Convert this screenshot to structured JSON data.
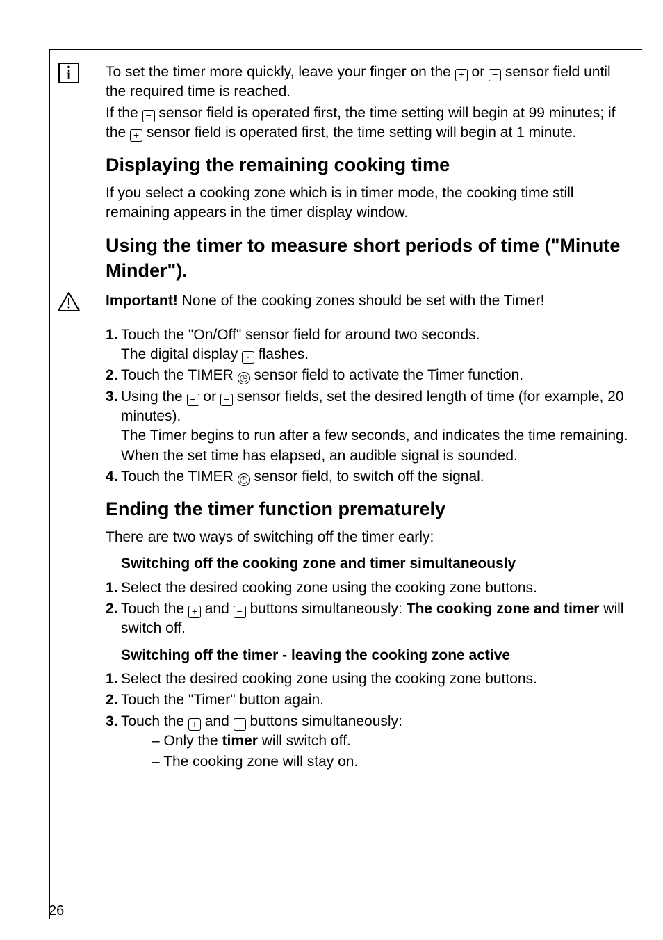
{
  "intro": {
    "p1a": "To set the timer more quickly, leave your finger on the ",
    "p1b": " or ",
    "p1c": " sensor field until the required time is reached.",
    "p2a": "If the ",
    "p2b": " sensor field is operated first, the time setting will begin at 99 minutes; if the ",
    "p2c": " sensor field is operated first, the time setting will begin at 1 minute."
  },
  "section1": {
    "heading": "Displaying the remaining cooking time",
    "body": "If you select a cooking zone which is in timer mode, the cooking time still remaining appears in the timer display window."
  },
  "section2": {
    "heading": "Using the timer to measure short periods of time (\"Minute Minder\").",
    "important_label": "Important!",
    "important_text": " None of the cooking zones should be set with the Timer!",
    "step1a": "Touch the \"On/Off\" sensor field for around two seconds.",
    "step1b_a": "The digital display ",
    "step1b_b": " flashes.",
    "step2a": "Touch the TIMER ",
    "step2b": " sensor field to activate the Timer function.",
    "step3a_a": "Using the ",
    "step3a_b": " or ",
    "step3a_c": " sensor fields, set the desired length of time (for example, 20 minutes).",
    "step3b": "The Timer begins to run after a few seconds, and indicates the time remaining.",
    "step3c": "When the set time has elapsed, an audible signal is sounded.",
    "step4a": "Touch the TIMER ",
    "step4b": " sensor field, to switch off the signal."
  },
  "section3": {
    "heading": "Ending the timer function prematurely",
    "intro": "There are two ways of switching off the timer early:",
    "sub1_heading": "Switching off the cooking zone and timer simultaneously",
    "sub1_step1": "Select the desired cooking zone using the cooking zone buttons.",
    "sub1_step2a": "Touch the ",
    "sub1_step2b": " and ",
    "sub1_step2c": " buttons simultaneously: ",
    "sub1_step2d": "The cooking zone and timer",
    "sub1_step2e": " will switch off.",
    "sub2_heading": "Switching off the timer - leaving the cooking zone active",
    "sub2_step1": "Select the desired cooking zone using the cooking zone buttons.",
    "sub2_step2": "Touch the \"Timer\" button again.",
    "sub2_step3a": "Touch the ",
    "sub2_step3b": " and ",
    "sub2_step3c": " buttons simultaneously:",
    "sub2_bullet1a": "Only the ",
    "sub2_bullet1b": "timer",
    "sub2_bullet1c": " will switch off.",
    "sub2_bullet2": "The cooking zone will stay on."
  },
  "icons": {
    "plus": "+",
    "minus": "−",
    "dot": "·",
    "timer": "◷"
  },
  "numbers": {
    "n1": "1.",
    "n2": "2.",
    "n3": "3.",
    "n4": "4."
  },
  "page_number": "26"
}
